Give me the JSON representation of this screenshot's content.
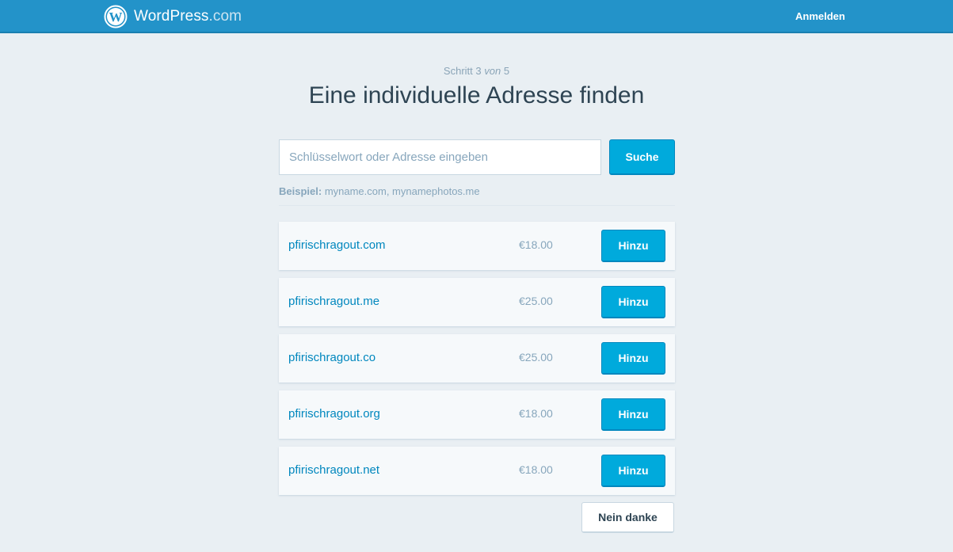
{
  "header": {
    "brand_main": "WordPress",
    "brand_suffix": ".com",
    "login_label": "Anmelden",
    "logo_icon": "wordpress-logo-icon",
    "bar_color": "#2393c9"
  },
  "step": {
    "prefix": "Schritt 3",
    "of_word": "von",
    "total": "5"
  },
  "title": "Eine individuelle Adresse finden",
  "search": {
    "value": "",
    "placeholder": "Schlüsselwort oder Adresse eingeben",
    "button_label": "Suche",
    "example_label": "Beispiel:",
    "example_text": "myname.com, mynamephotos.me"
  },
  "results": [
    {
      "domain": "pfirischragout.com",
      "price": "€18.00",
      "button": "Hinzu"
    },
    {
      "domain": "pfirischragout.me",
      "price": "€25.00",
      "button": "Hinzu"
    },
    {
      "domain": "pfirischragout.co",
      "price": "€25.00",
      "button": "Hinzu"
    },
    {
      "domain": "pfirischragout.org",
      "price": "€18.00",
      "button": "Hinzu"
    },
    {
      "domain": "pfirischragout.net",
      "price": "€18.00",
      "button": "Hinzu"
    }
  ],
  "skip_label": "Nein danke",
  "colors": {
    "accent": "#00aadc",
    "link": "#0087be",
    "background": "#e9eff3"
  }
}
